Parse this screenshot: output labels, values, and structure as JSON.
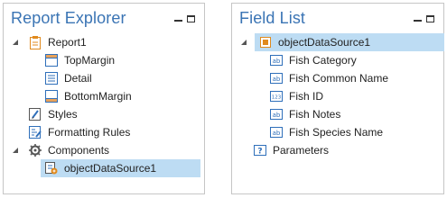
{
  "report_explorer": {
    "title": "Report Explorer",
    "items": [
      {
        "label": "Report1",
        "icon": "report-icon",
        "level": 0,
        "expanded": true
      },
      {
        "label": "TopMargin",
        "icon": "band-icon",
        "level": 1
      },
      {
        "label": "Detail",
        "icon": "detail-band-icon",
        "level": 1
      },
      {
        "label": "BottomMargin",
        "icon": "band-icon",
        "level": 1
      },
      {
        "label": "Styles",
        "icon": "styles-icon",
        "level": 0
      },
      {
        "label": "Formatting Rules",
        "icon": "formatting-rules-icon",
        "level": 0
      },
      {
        "label": "Components",
        "icon": "gear-icon",
        "level": 0,
        "expanded": true
      },
      {
        "label": "objectDataSource1",
        "icon": "object-datasource-icon",
        "level": 1,
        "selected": true
      }
    ]
  },
  "field_list": {
    "title": "Field List",
    "items": [
      {
        "label": "objectDataSource1",
        "icon": "datasource-icon",
        "level": 0,
        "expanded": true,
        "selected": true
      },
      {
        "label": "Fish Category",
        "icon": "string-field-icon",
        "icon_text": "ab",
        "level": 1
      },
      {
        "label": "Fish Common Name",
        "icon": "string-field-icon",
        "icon_text": "ab",
        "level": 1
      },
      {
        "label": "Fish ID",
        "icon": "number-field-icon",
        "icon_text": "123",
        "level": 1
      },
      {
        "label": "Fish Notes",
        "icon": "string-field-icon",
        "icon_text": "ab",
        "level": 1
      },
      {
        "label": "Fish Species Name",
        "icon": "string-field-icon",
        "icon_text": "ab",
        "level": 1
      },
      {
        "label": "Parameters",
        "icon": "parameters-icon",
        "icon_text": "?",
        "level": 0
      }
    ]
  },
  "colors": {
    "title": "#3a74b4",
    "selection": "#bddcf3",
    "icon_blue": "#2f6fba",
    "icon_orange": "#e08a1e"
  }
}
